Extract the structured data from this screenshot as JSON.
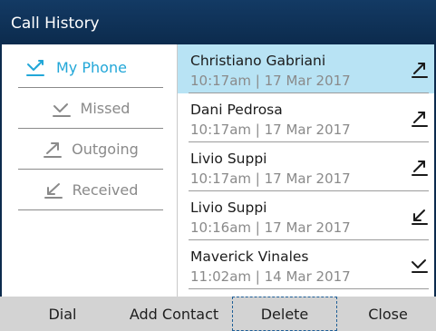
{
  "title": "Call History",
  "filters": [
    {
      "label": "My Phone",
      "icon": "all-calls-icon",
      "active": true
    },
    {
      "label": "Missed",
      "icon": "missed-call-icon",
      "active": false
    },
    {
      "label": "Outgoing",
      "icon": "outgoing-call-icon",
      "active": false
    },
    {
      "label": "Received",
      "icon": "received-call-icon",
      "active": false
    }
  ],
  "calls": [
    {
      "name": "Christiano Gabriani",
      "time": "10:17am",
      "date": "17 Mar 2017",
      "meta": "10:17am | 17 Mar 2017",
      "type": "outgoing",
      "icon": "outgoing-call-icon",
      "selected": true
    },
    {
      "name": "Dani Pedrosa",
      "time": "10:17am",
      "date": "17 Mar 2017",
      "meta": "10:17am | 17 Mar 2017",
      "type": "outgoing",
      "icon": "outgoing-call-icon",
      "selected": false
    },
    {
      "name": "Livio Suppi",
      "time": "10:17am",
      "date": "17 Mar 2017",
      "meta": "10:17am | 17 Mar 2017",
      "type": "outgoing",
      "icon": "outgoing-call-icon",
      "selected": false
    },
    {
      "name": "Livio Suppi",
      "time": "10:16am",
      "date": "17 Mar 2017",
      "meta": "10:16am | 17 Mar 2017",
      "type": "received",
      "icon": "received-call-icon",
      "selected": false
    },
    {
      "name": "Maverick Vinales",
      "time": "11:02am",
      "date": "14 Mar 2017",
      "meta": "11:02am | 14 Mar 2017",
      "type": "missed",
      "icon": "missed-call-icon",
      "selected": false
    }
  ],
  "softkeys": [
    {
      "label": "Dial"
    },
    {
      "label": "Add Contact"
    },
    {
      "label": "Delete",
      "focused": true
    },
    {
      "label": "Close"
    }
  ],
  "colors": {
    "title_bar": "#0c2b4d",
    "selected_row": "#b8e3f4",
    "active_filter": "#22a7d8",
    "muted_text": "#8a8a8a",
    "softkey_bar": "#d3d3d3"
  }
}
